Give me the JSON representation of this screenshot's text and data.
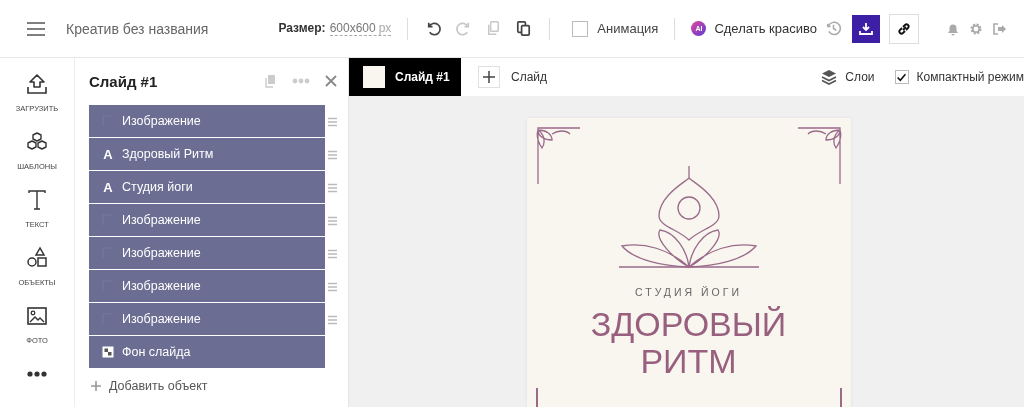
{
  "header": {
    "title": "Креатив без названия",
    "size_label": "Размер:",
    "size_value": "600x600",
    "size_unit": "px",
    "history": [
      {
        "kind": "undo",
        "disabled": false
      },
      {
        "kind": "redo",
        "disabled": true
      },
      {
        "kind": "copy",
        "disabled": true
      },
      {
        "kind": "paste",
        "disabled": false
      }
    ],
    "animation": {
      "label": "Анимация",
      "checked": false
    },
    "ai_button": {
      "badge": "AI",
      "label": "Сделать красиво"
    }
  },
  "sidebar": {
    "items": [
      {
        "kind": "upload",
        "label": "ЗАГРУЗИТЬ"
      },
      {
        "kind": "templates",
        "label": "ШАБЛОНЫ"
      },
      {
        "kind": "text",
        "label": "ТЕКСТ"
      },
      {
        "kind": "objects",
        "label": "ОБЪЕКТЫ"
      },
      {
        "kind": "photo",
        "label": "ФОТО"
      },
      {
        "kind": "more"
      }
    ]
  },
  "panel": {
    "title": "Слайд #1",
    "layers": [
      {
        "kind": "image",
        "label": "Изображение"
      },
      {
        "kind": "text",
        "icon": "A",
        "label": "Здоровый Ритм"
      },
      {
        "kind": "text",
        "icon": "A",
        "label": "Студия йоги"
      },
      {
        "kind": "image",
        "label": "Изображение"
      },
      {
        "kind": "image",
        "label": "Изображение"
      },
      {
        "kind": "image",
        "label": "Изображение"
      },
      {
        "kind": "image",
        "label": "Изображение"
      },
      {
        "kind": "background",
        "label": "Фон слайда"
      }
    ],
    "add_label": "Добавить объект"
  },
  "canvas_toolbar": {
    "slide_tab": {
      "label": "Слайд #1",
      "selected": true
    },
    "add_slide": "Слайд",
    "layers": "Слои",
    "compact": {
      "label": "Компактный режим",
      "checked": true
    }
  },
  "slide": {
    "subtitle": "СТУДИЯ ЙОГИ",
    "title": "ЗДОРОВЫЙ РИТМ"
  }
}
